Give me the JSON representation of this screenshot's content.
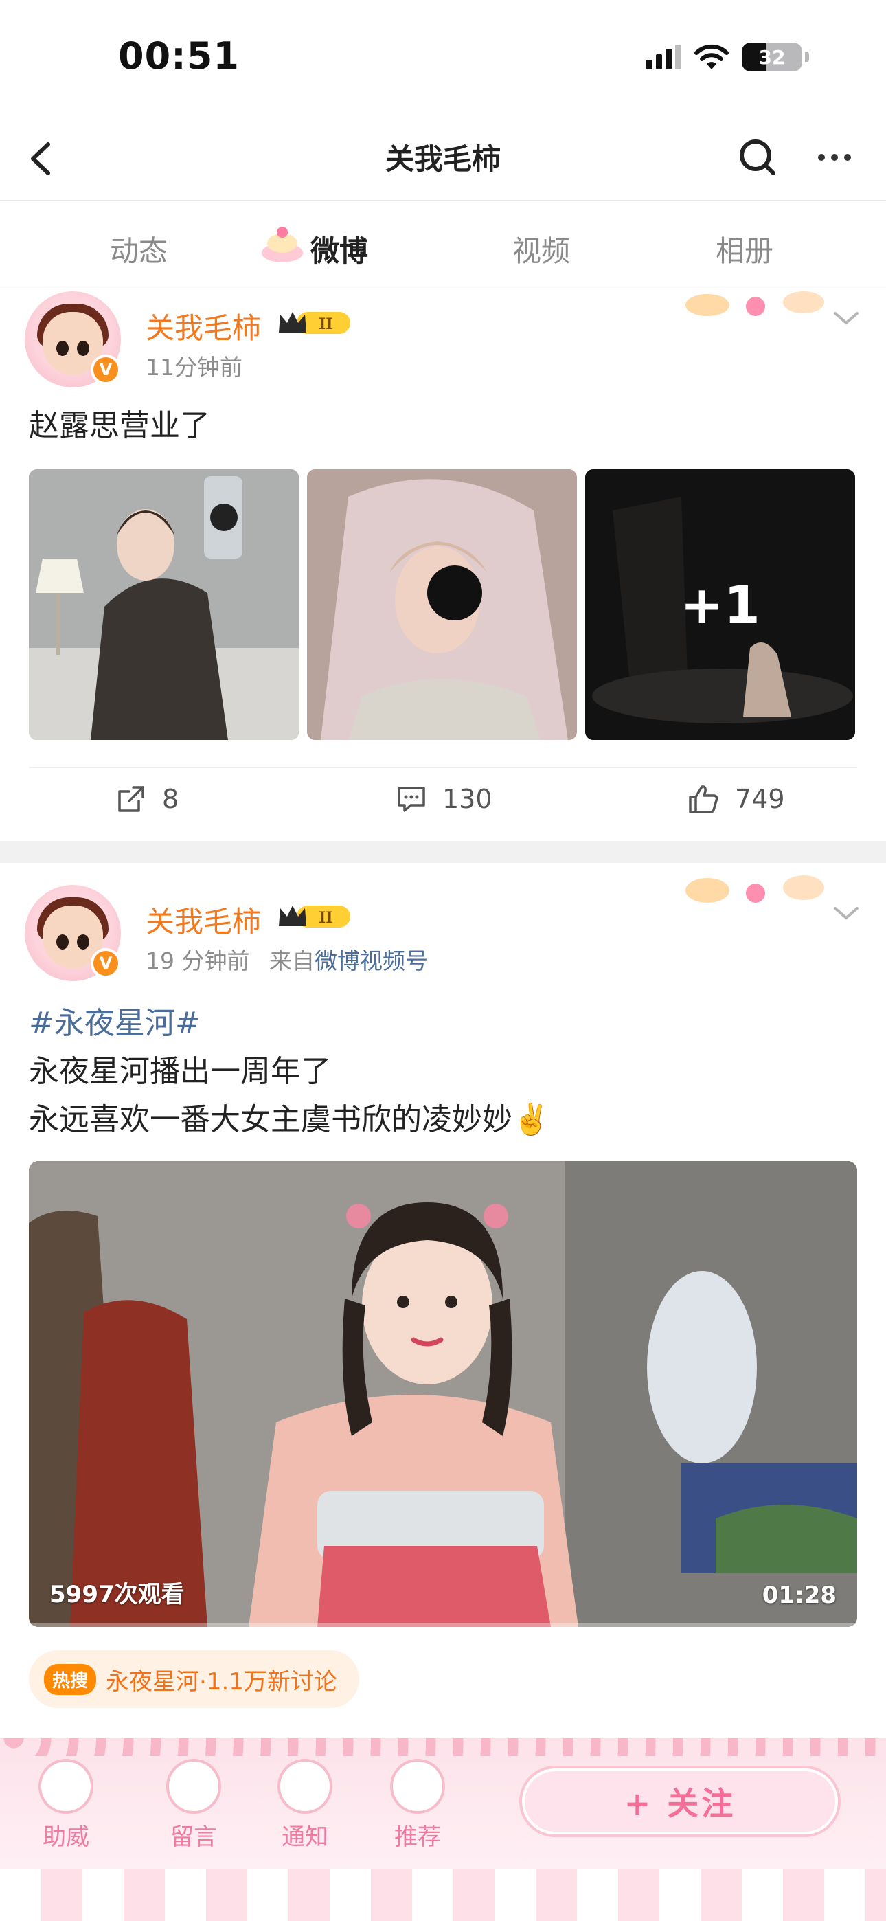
{
  "status_bar": {
    "time": "00:51",
    "battery": "32"
  },
  "nav": {
    "title": "关我毛柿"
  },
  "tabs": [
    {
      "label": "动态",
      "active": false
    },
    {
      "label": "微博",
      "active": true
    },
    {
      "label": "视频",
      "active": false
    },
    {
      "label": "相册",
      "active": false
    }
  ],
  "posts": [
    {
      "user": "关我毛柿",
      "time": "11分钟前",
      "text": "赵露思营业了",
      "images": {
        "count_shown": 3,
        "more_label": "+1"
      },
      "actions": {
        "reposts": "8",
        "comments": "130",
        "likes": "749"
      }
    },
    {
      "user": "关我毛柿",
      "time": "19 分钟前",
      "source_prefix": "来自",
      "source": "微博视频号",
      "topic": "#永夜星河#",
      "line1": "永夜星河播出一周年了",
      "line2": "永远喜欢一番大女主虞书欣的凌妙妙✌️",
      "video": {
        "views": "5997次观看",
        "duration": "01:28"
      },
      "hot": {
        "tag": "热搜",
        "text": "永夜星河·1.1万新讨论"
      }
    }
  ],
  "bottom_bar": {
    "items": [
      "助威",
      "留言",
      "通知",
      "推荐"
    ],
    "follow": "+ 关注"
  },
  "colors": {
    "accent": "#f4791e",
    "link": "#4a6d9c",
    "hot": "#ff8a00",
    "pink": "#f36f97"
  },
  "icons": [
    "back-icon",
    "search-icon",
    "more-icon",
    "repost-icon",
    "comment-icon",
    "like-icon",
    "verified-icon",
    "vip-crown-icon",
    "chevron-down-icon",
    "wifi-icon",
    "signal-icon",
    "battery-icon"
  ]
}
